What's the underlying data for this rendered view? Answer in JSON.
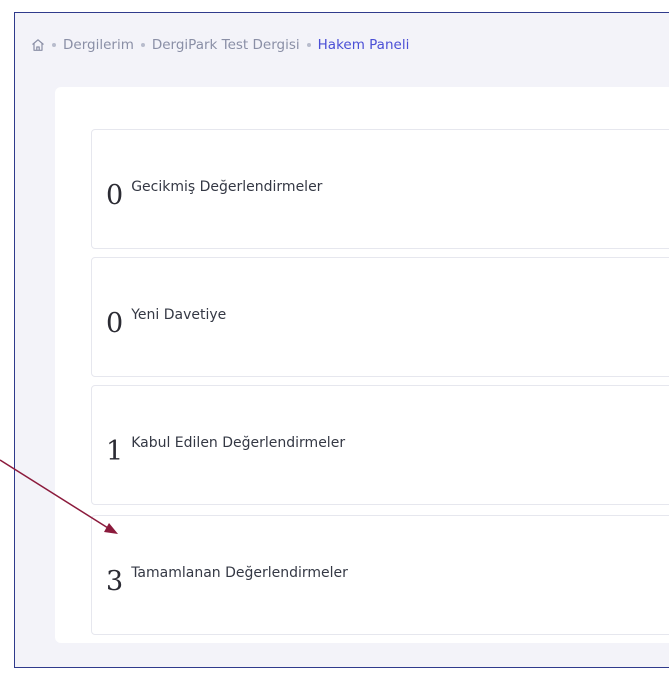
{
  "breadcrumb": {
    "home_icon": "home-icon",
    "items": [
      "Dergilerim",
      "DergiPark Test Dergisi",
      "Hakem Paneli"
    ]
  },
  "cards": [
    {
      "count": "0",
      "label": "Gecikmiş Değerlendirmeler"
    },
    {
      "count": "0",
      "label": "Yeni Davetiye"
    },
    {
      "count": "1",
      "label": "Kabul Edilen Değerlendirmeler"
    },
    {
      "count": "3",
      "label": "Tamamlanan Değerlendirmeler"
    }
  ],
  "colors": {
    "accent": "#4b4fd6",
    "frame_border": "#2f3a8c",
    "arrow": "#8b1a3c",
    "background": "#f3f3f9"
  }
}
